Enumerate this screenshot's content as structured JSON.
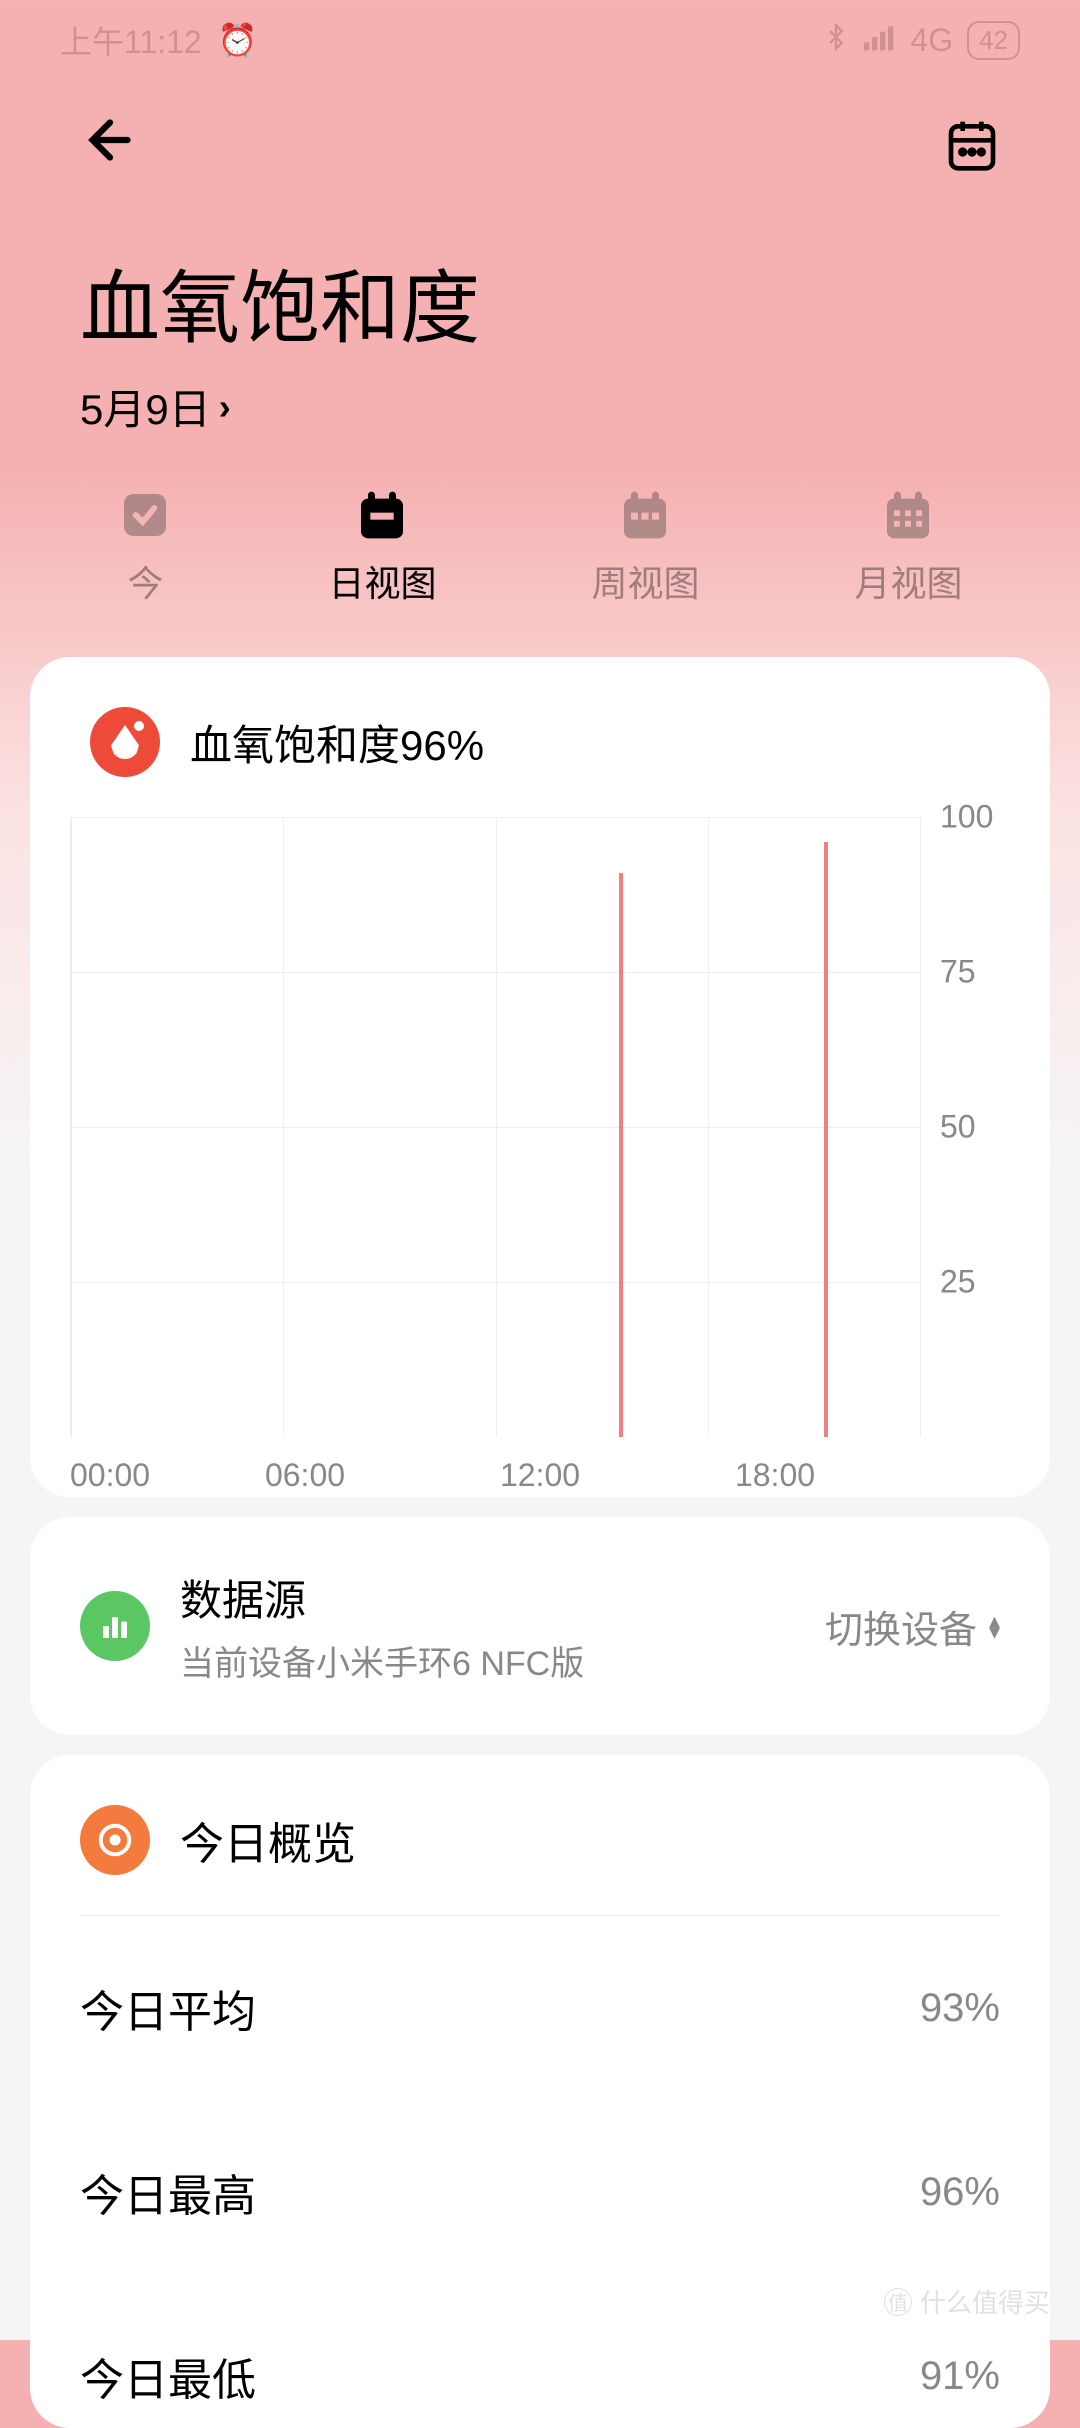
{
  "status": {
    "time": "上午11:12",
    "network": "4G",
    "battery": "42"
  },
  "header": {
    "title": "血氧饱和度",
    "date": "5月9日"
  },
  "tabs": [
    {
      "label": "今",
      "icon": "today"
    },
    {
      "label": "日视图",
      "icon": "day"
    },
    {
      "label": "周视图",
      "icon": "week"
    },
    {
      "label": "月视图",
      "icon": "month"
    }
  ],
  "chart": {
    "title": "血氧饱和度96%"
  },
  "chart_data": {
    "type": "bar",
    "title": "血氧饱和度96%",
    "xlabel": "",
    "ylabel": "",
    "ylim": [
      0,
      100
    ],
    "x_ticks": [
      "00:00",
      "06:00",
      "12:00",
      "18:00"
    ],
    "y_ticks": [
      25,
      50,
      75,
      100
    ],
    "points": [
      {
        "time_hour": 15.5,
        "value": 91
      },
      {
        "time_hour": 21.3,
        "value": 96
      }
    ]
  },
  "source": {
    "title": "数据源",
    "subtitle": "当前设备小米手环6 NFC版",
    "switch_label": "切换设备"
  },
  "overview": {
    "title": "今日概览",
    "rows": [
      {
        "label": "今日平均",
        "value": "93%"
      },
      {
        "label": "今日最高",
        "value": "96%"
      },
      {
        "label": "今日最低",
        "value": "91%"
      }
    ]
  },
  "watermark": "什么值得买"
}
